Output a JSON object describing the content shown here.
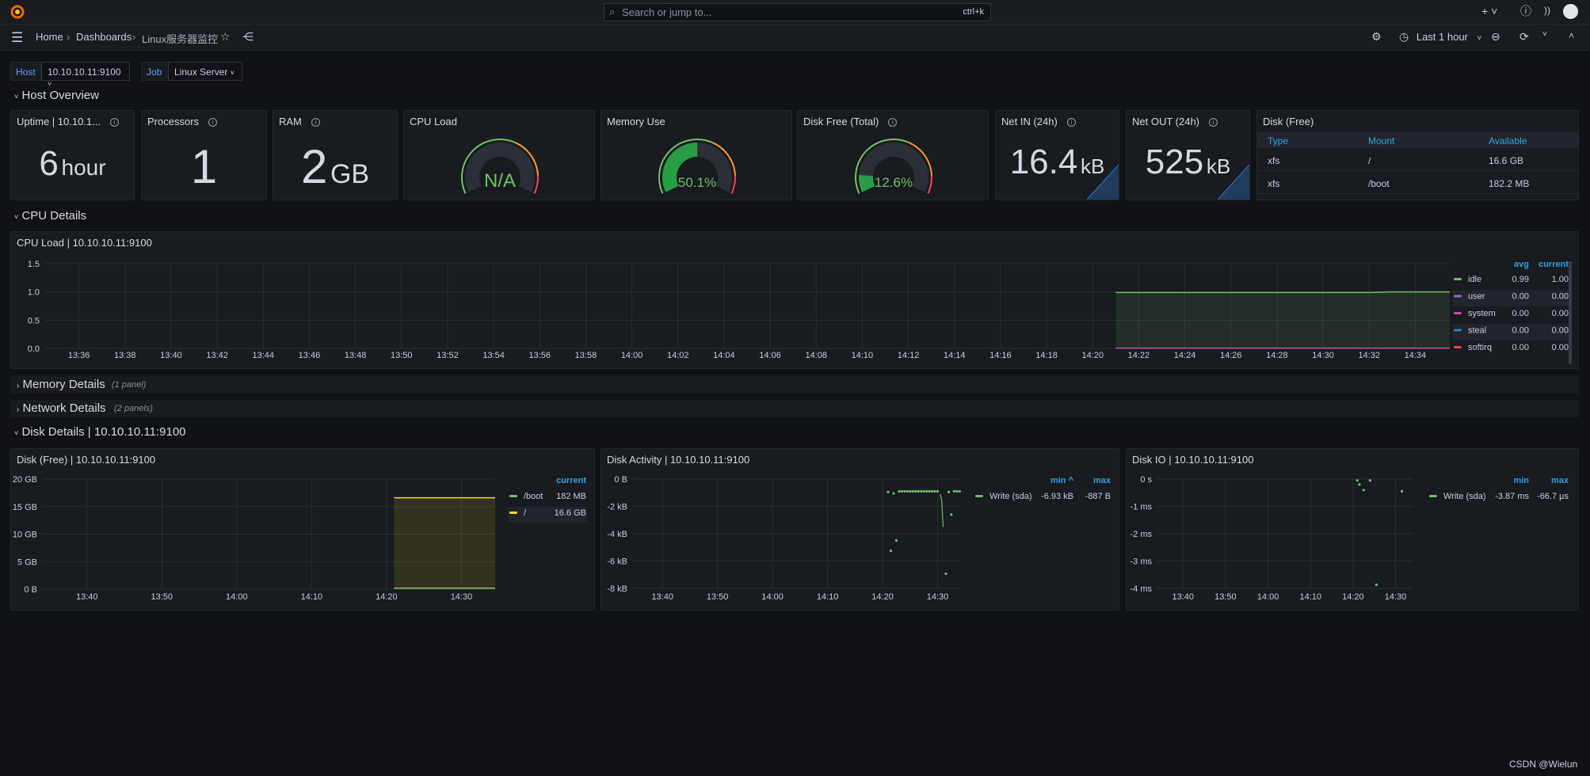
{
  "topbar": {
    "search_placeholder": "Search or jump to...",
    "shortcut": "ctrl+k",
    "icons": [
      "grafana-logo-icon",
      "search-icon",
      "keyboard-icon",
      "plus-icon",
      "help-icon",
      "rss-icon",
      "avatar-icon"
    ]
  },
  "nav": {
    "breadcrumbs": [
      "Home",
      "Dashboards",
      "Linux服务器监控"
    ],
    "time_range": "Last 1 hour"
  },
  "variables": [
    {
      "label": "Host",
      "value": "10.10.10.11:9100"
    },
    {
      "label": "Job",
      "value": "Linux Server"
    }
  ],
  "rows": {
    "host_overview": "Host Overview",
    "cpu_details": "CPU Details",
    "memory_details": "Memory Details",
    "memory_count": "(1 panel)",
    "network_details": "Network Details",
    "network_count": "(2 panels)",
    "disk_details": "Disk Details | 10.10.10.11:9100"
  },
  "stats": [
    {
      "title": "Uptime | 10.10.1...",
      "value": "6",
      "unit": "hour"
    },
    {
      "title": "Processors",
      "value": "1",
      "unit": ""
    },
    {
      "title": "RAM",
      "value": "2",
      "unit": "GB"
    }
  ],
  "gauges": [
    {
      "title": "CPU Load",
      "value_text": "N/A",
      "percent": null
    },
    {
      "title": "Memory Use",
      "value_text": "50.1%",
      "percent": 50.1
    },
    {
      "title": "Disk Free (Total)",
      "value_text": "12.6%",
      "percent": 12.6
    }
  ],
  "net": [
    {
      "title": "Net IN (24h)",
      "value": "16.4",
      "unit": "kB"
    },
    {
      "title": "Net OUT (24h)",
      "value": "525",
      "unit": "kB"
    }
  ],
  "disk_table": {
    "title": "Disk (Free)",
    "columns": [
      "Type",
      "Mount",
      "Available"
    ],
    "rows": [
      [
        "xfs",
        "/",
        "16.6 GB"
      ],
      [
        "xfs",
        "/boot",
        "182.2 MB"
      ]
    ]
  },
  "colors": {
    "green": "#37872d",
    "green_text": "#73bf69",
    "orange": "#ff9830",
    "red": "#f2495c",
    "accent": "#33a2e5",
    "bg": "#111217",
    "panel": "#181b1f"
  },
  "chart_data": [
    {
      "id": "cpu",
      "type": "line",
      "title": "CPU Load | 10.10.10.11:9100",
      "x_range": [
        "13:34:30",
        "14:35:30"
      ],
      "ylim": [
        0,
        1.5
      ],
      "yticks": [
        {
          "v": 0,
          "label": "0.0"
        },
        {
          "v": 0.5,
          "label": "0.5"
        },
        {
          "v": 1,
          "label": "1.0"
        },
        {
          "v": 1.5,
          "label": "1.5"
        }
      ],
      "xticks": [
        "13:36",
        "13:38",
        "13:40",
        "13:42",
        "13:44",
        "13:46",
        "13:48",
        "13:50",
        "13:52",
        "13:54",
        "13:56",
        "13:58",
        "14:00",
        "14:02",
        "14:04",
        "14:06",
        "14:08",
        "14:10",
        "14:12",
        "14:14",
        "14:16",
        "14:18",
        "14:20",
        "14:22",
        "14:24",
        "14:26",
        "14:28",
        "14:30",
        "14:32",
        "14:34"
      ],
      "legend_headers": [
        "avg",
        "current"
      ],
      "series": [
        {
          "name": "idle",
          "color": "#73bf69",
          "avg": "0.99",
          "current": "1.00",
          "fill": true,
          "points": [
            [
              "14:21",
              0.99
            ],
            [
              "14:32",
              0.99
            ],
            [
              "14:33",
              1.0
            ],
            [
              "14:35:30",
              1.0
            ]
          ]
        },
        {
          "name": "user",
          "color": "#8f6dc9",
          "avg": "0.00",
          "current": "0.00",
          "points": [
            [
              "14:21",
              0.005
            ],
            [
              "14:35:30",
              0.005
            ]
          ]
        },
        {
          "name": "system",
          "color": "#c94ba6",
          "avg": "0.00",
          "current": "0.00",
          "points": [
            [
              "14:21",
              0.003
            ],
            [
              "14:35:30",
              0.003
            ]
          ]
        },
        {
          "name": "steal",
          "color": "#2f80d0",
          "avg": "0.00",
          "current": "0.00",
          "points": []
        },
        {
          "name": "softirq",
          "color": "#e0503c",
          "avg": "0.00",
          "current": "0.00",
          "points": []
        }
      ]
    },
    {
      "id": "diskfree",
      "type": "area",
      "title": "Disk (Free) | 10.10.10.11:9100",
      "x_range": [
        "13:34:00",
        "14:34:30"
      ],
      "ylim": [
        0,
        20
      ],
      "yticks": [
        {
          "v": 0,
          "label": "0 B"
        },
        {
          "v": 5,
          "label": "5 GB"
        },
        {
          "v": 10,
          "label": "10 GB"
        },
        {
          "v": 15,
          "label": "15 GB"
        },
        {
          "v": 20,
          "label": "20 GB"
        }
      ],
      "xticks": [
        "13:40",
        "13:50",
        "14:00",
        "14:10",
        "14:20",
        "14:30"
      ],
      "legend_headers": [
        "current"
      ],
      "series": [
        {
          "name": "/boot",
          "color": "#73bf69",
          "current": "182 MB",
          "points": [
            [
              "14:21",
              0.182
            ],
            [
              "14:34:30",
              0.182
            ]
          ]
        },
        {
          "name": "/",
          "color": "#fade2a",
          "current": "16.6 GB",
          "fill": true,
          "points": [
            [
              "14:21",
              16.6
            ],
            [
              "14:34:30",
              16.6
            ]
          ]
        }
      ]
    },
    {
      "id": "diskact",
      "type": "scatter",
      "title": "Disk Activity | 10.10.10.11:9100",
      "x_range": [
        "13:34:30",
        "14:34:06"
      ],
      "ylim": [
        -8,
        0
      ],
      "yticks": [
        {
          "v": 0,
          "label": "0 B"
        },
        {
          "v": -2,
          "label": "-2 kB"
        },
        {
          "v": -4,
          "label": "-4 kB"
        },
        {
          "v": -6,
          "label": "-6 kB"
        },
        {
          "v": -8,
          "label": "-8 kB"
        }
      ],
      "xticks": [
        "13:40",
        "13:50",
        "14:00",
        "14:10",
        "14:20",
        "14:30"
      ],
      "legend_headers": [
        "min ^",
        "max"
      ],
      "series": [
        {
          "name": "Write (sda)",
          "color": "#73bf69",
          "min": "-6.93 kB",
          "max": "-887 B",
          "points": [
            [
              "14:21",
              -0.95
            ],
            [
              "14:21:30",
              -5.25
            ],
            [
              "14:22",
              -1.05
            ],
            [
              "14:22:30",
              -4.5
            ],
            [
              "14:23",
              -0.9
            ],
            [
              "14:23:30",
              -0.9
            ],
            [
              "14:24",
              -0.9
            ],
            [
              "14:24:30",
              -0.9
            ],
            [
              "14:25",
              -0.9
            ],
            [
              "14:25:30",
              -0.9
            ],
            [
              "14:26",
              -0.9
            ],
            [
              "14:26:30",
              -0.9
            ],
            [
              "14:27",
              -0.9
            ],
            [
              "14:27:30",
              -0.9
            ],
            [
              "14:28",
              -0.9
            ],
            [
              "14:28:30",
              -0.9
            ],
            [
              "14:29",
              -0.9
            ],
            [
              "14:29:30",
              -0.9
            ],
            [
              "14:30",
              -0.9
            ],
            [
              "14:31:30",
              -6.93
            ],
            [
              "14:32",
              -0.95
            ],
            [
              "14:32:30",
              -2.6
            ],
            [
              "14:33",
              -0.9
            ],
            [
              "14:33:30",
              -0.9
            ],
            [
              "14:34",
              -0.9
            ]
          ],
          "line": [
            [
              "14:30:30",
              -1.1
            ],
            [
              "14:30:45",
              -1.6
            ],
            [
              "14:31",
              -3.5
            ]
          ]
        }
      ]
    },
    {
      "id": "diskio",
      "type": "scatter",
      "title": "Disk IO | 10.10.10.11:9100",
      "x_range": [
        "13:33:48",
        "14:34:00"
      ],
      "ylim": [
        -4,
        0
      ],
      "yticks": [
        {
          "v": 0,
          "label": "0 s"
        },
        {
          "v": -1,
          "label": "-1 ms"
        },
        {
          "v": -2,
          "label": "-2 ms"
        },
        {
          "v": -3,
          "label": "-3 ms"
        },
        {
          "v": -4,
          "label": "-4 ms"
        }
      ],
      "xticks": [
        "13:40",
        "13:50",
        "14:00",
        "14:10",
        "14:20",
        "14:30"
      ],
      "legend_headers": [
        "min",
        "max"
      ],
      "series": [
        {
          "name": "Write (sda)",
          "color": "#73bf69",
          "min": "-3.87 ms",
          "max": "-66.7 µs",
          "points": [
            [
              "14:21",
              -0.05
            ],
            [
              "14:21:30",
              -0.2
            ],
            [
              "14:22:30",
              -0.4
            ],
            [
              "14:24",
              -0.05
            ],
            [
              "14:25:30",
              -3.87
            ],
            [
              "14:31:30",
              -0.45
            ]
          ]
        }
      ]
    }
  ],
  "watermark": "CSDN @Wielun"
}
